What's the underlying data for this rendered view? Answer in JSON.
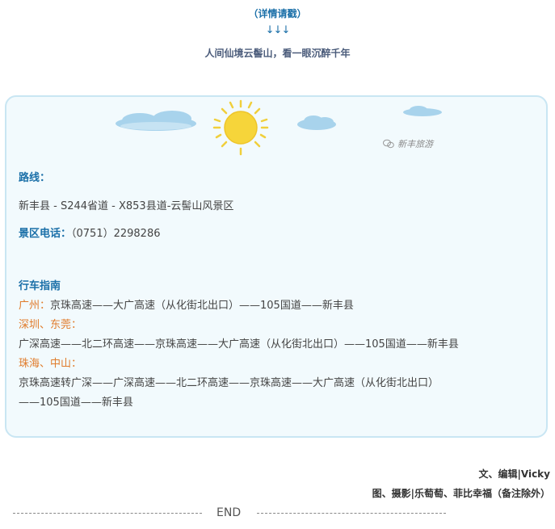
{
  "header": {
    "details": "（详情请戳）",
    "arrows": "↓↓↓",
    "tagline": "人间仙境云髻山，看一眼沉醉千年"
  },
  "card": {
    "brand": "新丰旅游",
    "route_label": "路线：",
    "route_text": "新丰县 - S244省道 - X853县道-云髻山风景区",
    "phone_label": "景区电话：",
    "phone_text": "（0751）2298286",
    "guide_title": "行车指南",
    "guangzhou_label": "广州：",
    "guangzhou_text": "京珠高速——大广高速（从化街北出口）——105国道——新丰县",
    "shenzhen_label": "深圳、东莞：",
    "shenzhen_text": "广深高速——北二环高速——京珠高速——大广高速（从化街北出口）——105国道——新丰县",
    "zhuhai_label": "珠海、中山：",
    "zhuhai_text1": "京珠高速转广深——广深高速——北二环高速——京珠高速——大广高速（从化街北出口）",
    "zhuhai_text2": "——105国道——新丰县"
  },
  "footer": {
    "credit_text": "文、编辑|Vicky",
    "credit_photo": "图、摄影|乐萄萄、菲比幸福（备注除外）",
    "end": "END"
  },
  "colors": {
    "accent_blue": "#1a6fa8",
    "accent_orange": "#e07b2a",
    "card_border": "#c9e6f3",
    "card_bg": "#f2fafd",
    "sun": "#f6d53a",
    "cloud": "#a8d3ec"
  }
}
